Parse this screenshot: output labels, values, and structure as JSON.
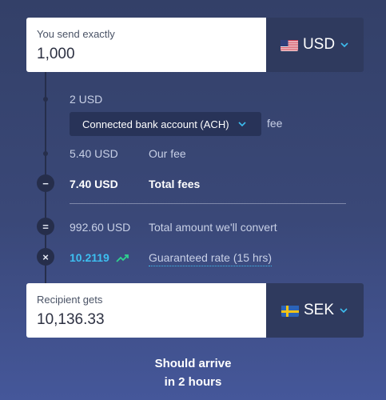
{
  "send": {
    "label": "You send exactly",
    "value": "1,000",
    "currency": "USD",
    "flag": "us-flag-icon"
  },
  "breakdown": {
    "ach_fee_amount": "2 USD",
    "payment_method": "Connected bank account (ACH)",
    "ach_fee_suffix": "fee",
    "our_fee_amount": "5.40 USD",
    "our_fee_label": "Our fee",
    "total_fees_amount": "7.40 USD",
    "total_fees_label": "Total fees",
    "convert_amount": "992.60 USD",
    "convert_label": "Total amount we'll convert",
    "rate_value": "10.2119",
    "rate_label": "Guaranteed rate (15 hrs)",
    "minus_symbol": "−",
    "equals_symbol": "=",
    "times_symbol": "×"
  },
  "receive": {
    "label": "Recipient gets",
    "value": "10,136.33",
    "currency": "SEK",
    "flag": "se-flag-icon"
  },
  "arrival": {
    "line1": "Should arrive",
    "line2": "in 2 hours"
  },
  "colors": {
    "accent": "#3dbef0",
    "trend": "#2fd38f",
    "rail": "#262e4b",
    "button": "#2f3a5e"
  }
}
